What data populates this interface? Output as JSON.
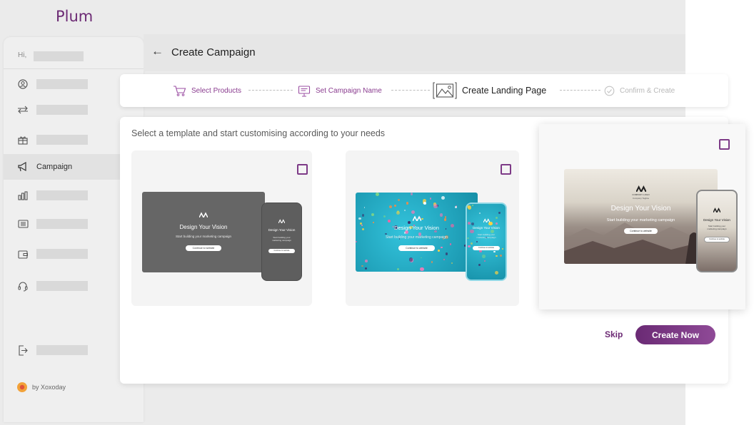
{
  "brand": {
    "name": "Plum"
  },
  "sidebar": {
    "greeting": "Hi,",
    "items": [
      {
        "icon": "user-circle-icon",
        "label": ""
      },
      {
        "icon": "swap-arrows-icon",
        "label": ""
      },
      {
        "icon": "gift-box-icon",
        "label": ""
      },
      {
        "icon": "megaphone-icon",
        "label": "Campaign",
        "active": true
      },
      {
        "icon": "bar-chart-icon",
        "label": ""
      },
      {
        "icon": "list-card-icon",
        "label": ""
      },
      {
        "icon": "wallet-icon",
        "label": ""
      },
      {
        "icon": "headset-icon",
        "label": ""
      },
      {
        "icon": "logout-icon",
        "label": ""
      }
    ],
    "by_label": "by Xoxoday"
  },
  "header": {
    "back_icon": "arrow-left-icon",
    "title": "Create Campaign"
  },
  "stepper": {
    "steps": [
      {
        "icon": "cart-icon",
        "label": "Select Products",
        "state": "done"
      },
      {
        "icon": "signboard-icon",
        "label": "Set Campaign Name",
        "state": "done"
      },
      {
        "icon": "landscape-image-icon",
        "label": "Create Landing Page",
        "state": "current"
      },
      {
        "icon": "check-circle-icon",
        "label": "Confirm & Create",
        "state": "pending"
      }
    ]
  },
  "main": {
    "instruction": "Select a template and start customising according to your needs",
    "templates": [
      {
        "style": "dark-gray",
        "selected": false,
        "desktop": {
          "headline": "Design Your Vision",
          "subtext": "Start building your marketing campaign",
          "button": "Continue to website"
        },
        "mobile": {
          "headline": "Design Your Vision",
          "subtext": "Start building your marketing campaign",
          "button": "Continue to website"
        }
      },
      {
        "style": "teal-confetti",
        "selected": false,
        "desktop": {
          "headline": "Design Your Vision",
          "subtext": "Start building your marketing campaign",
          "button": "Continue to website"
        },
        "mobile": {
          "headline": "Design Your Vision",
          "subtext": "Start building your marketing campaign",
          "button": "Continue to website"
        }
      },
      {
        "style": "mountain-photo",
        "selected": true,
        "desktop": {
          "company": "COMPANY LOGO",
          "tagline": "Company Tagline",
          "headline": "Design Your Vision",
          "subtext": "Start building your marketing campaign",
          "button": "Continue to website"
        },
        "mobile": {
          "headline": "Design Your Vision",
          "subtext": "Start building your marketing campaign",
          "button": "Continue to website"
        }
      }
    ]
  },
  "actions": {
    "skip_label": "Skip",
    "create_label": "Create Now"
  },
  "colors": {
    "brand": "#6c2a74",
    "accent": "#8f4a97",
    "teal": "#1fa9c4",
    "dark_template": "#666666"
  }
}
